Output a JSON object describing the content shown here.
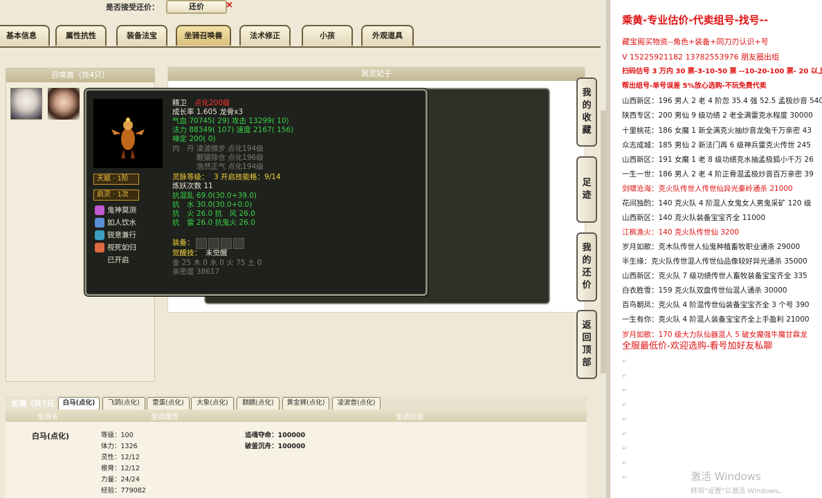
{
  "topbar": {
    "question": "是否接受还价：",
    "counter_btn": "还价",
    "close": "×"
  },
  "tabs": [
    "基本信息",
    "属性抗性",
    "装备法宝",
    "坐骑召唤兽",
    "法术修正",
    "小孩",
    "外观道具"
  ],
  "summon_panel": {
    "title": "召唤兽（共4只）"
  },
  "bg_panel": {
    "title": "冥灵妃子"
  },
  "side_buttons": [
    {
      "chars": [
        "我",
        "的",
        "收",
        "藏"
      ]
    },
    {
      "chars": [
        "足",
        "迹"
      ]
    },
    {
      "chars": [
        "我",
        "的",
        "还",
        "价"
      ]
    },
    {
      "chars": [
        "返",
        "回",
        "顶",
        "部"
      ]
    }
  ],
  "tooltip": {
    "name": "精卫",
    "name_suffix": "点化200级",
    "growth": "成长率 1.605 龙骨x3",
    "hp": "气血 70745( 29) 攻击 13299( 10)",
    "mp": "法力 88349( 107) 速度 2167( 156)",
    "trait": "禅定 200( 0)",
    "neidan1": "内　丹 凌波微步 点化194级",
    "neidan2": "　　 　眠猿除仓 点化196级",
    "neidan3": "　　 　浩然正气 点化194级",
    "spirit_label": "灵脉等级：",
    "spirit_value": "3 开启技能格：9/14",
    "refine": "炼妖次数 11",
    "res1": "抗混乱 69.0(30.0+39.0)",
    "res2": "抗　水 30.0(30.0+0.0)",
    "res3": "抗　火 26.0 抗　风 26.0",
    "res4": "抗　雷 26.0 抗鬼火 26.0",
    "equip_label": "装备：",
    "awaken_label": "觉醒技：",
    "awaken_value": "未觉醒",
    "elements": "金 25 木 0 水 0 火 75 土 0",
    "intimacy": "亲密度 38617",
    "badge1": "天赋 · 1阶",
    "badge2": "启灵 · 1次",
    "skills": [
      "鬼神莫测",
      "如人饮水",
      "锐意兼行",
      "视死如归",
      "已开启"
    ]
  },
  "mount": {
    "label": "坐骑（共7只",
    "tabs": [
      "白马(点化)",
      "飞鹍(点化)",
      "雷蛋(点化)",
      "大象(点化)",
      "麒麟(点化)",
      "黄金狮(点化)",
      "凌波兽(点化)"
    ],
    "columns": [
      "坐骑名",
      "坐骑属性",
      "坐骑技能"
    ],
    "name": "白马(点化)",
    "attrs": [
      "等级：100",
      "体力：1326",
      "灵性：12/12",
      "根骨：12/12",
      "力量：24/24",
      "经验：779082"
    ],
    "skills": [
      "追魂夺命：100000",
      "破釜沉舟：100000"
    ]
  },
  "right_panel": {
    "lines": [
      {
        "t": "乘黄-专业估价-代卖组号-找号--",
        "c": "red",
        "b": true,
        "s": 15
      },
      {
        "t": "藏宝阁买物资--角色+装备+同刀刃认识+号",
        "c": "red",
        "s": 11
      },
      {
        "t": "V 15225921182  13782553976 朋友圈出组",
        "c": "red",
        "s": 11
      },
      {
        "t": "扫码估号 3 万内 30 票-3-10-50 票 --10-20-100 票- 20 以上",
        "c": "red",
        "b": true,
        "s": 10
      },
      {
        "t": "帮出组号-单号误差 5%放心选购-不玩免费代卖",
        "c": "red",
        "b": true,
        "s": 10
      },
      {
        "t": "山西新区：196 男人 2 老 4 阶忽 35.4 强 52.5 孟极炒音 540",
        "c": "black"
      },
      {
        "t": "陕西专区：200 男仙 9 级功绩 2 老全满雷克水程度 30000",
        "c": "black"
      },
      {
        "t": "十里桃花：186 女魔 1 新全满克火抽炒音龙兔千万亲密 43",
        "c": "black"
      },
      {
        "t": "众志成城：185 男仙 2 新法门再 6 级神兵雷克火传世 245",
        "c": "black"
      },
      {
        "t": "山西新区：191 女魔 1 老 8 级功绩克水抽孟极狐小千万 26",
        "c": "black"
      },
      {
        "t": "一生一世：186 男人 2 老 4 阶正骨混孟极炒音百万亲密 39",
        "c": "black"
      },
      {
        "t": "剑啸沧海：克火队传世人传世仙异光秦岭通杀 21000",
        "c": "red"
      },
      {
        "t": "花间独酌：140 克火队 4 阶混人女鬼女人男鬼采矿 120 级",
        "c": "black"
      },
      {
        "t": "山西新区：140 克火队装备宝宝齐全 11000",
        "c": "black"
      },
      {
        "t": "江枫渔火：140 克火队传世仙 3200",
        "c": "red"
      },
      {
        "t": "岁月如歌：克木队传世人仙鬼种植畜牧职业通杀 29000",
        "c": "black"
      },
      {
        "t": "半生缘：克火队传世混人传世仙品像较好异光通杀 35000",
        "c": "black"
      },
      {
        "t": "山西新区：克火队 7 级功绩传世人畜牧装备宝宝齐全 335",
        "c": "black"
      },
      {
        "t": "白衣胜雪：159 克火队双盘传世仙混人通杀 30000",
        "c": "black"
      },
      {
        "t": "百鸟朝凤：克火队 4 阶混传世仙装备宝宝齐全 3 个号 390",
        "c": "black"
      },
      {
        "t": "一生有你：克火队 4 阶混人装备宝宝齐全上手盈利 21000",
        "c": "black"
      },
      {
        "t": "岁月如歌：170 级大力队仙器混人 5 破女魔强牛魔甘霖龙",
        "c": "red"
      },
      {
        "t": "全服最低价-欢迎选购-看号加好友私聊",
        "c": "red",
        "s": 13
      }
    ],
    "watermark1": "激活 Windows",
    "watermark2": "转到\"设置\"以激活 Windows。"
  }
}
